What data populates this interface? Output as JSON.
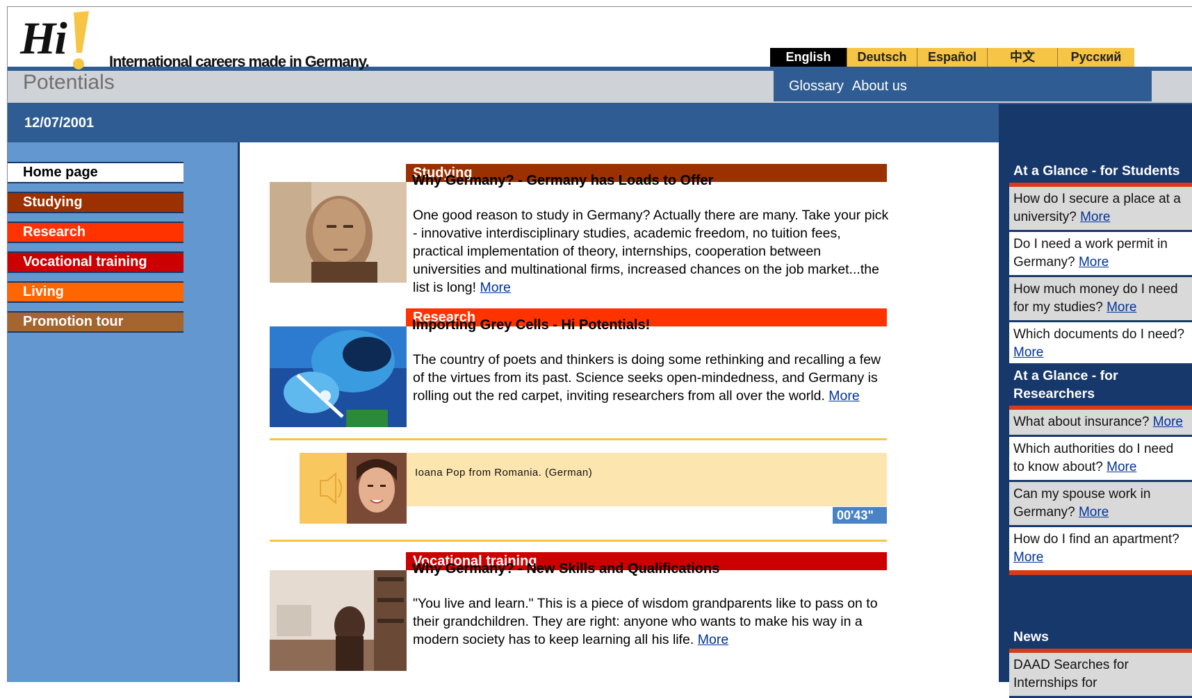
{
  "header": {
    "logo_hi": "Hi",
    "logo_potentials": "Potentials",
    "tagline": "International careers made in Germany."
  },
  "languages": [
    {
      "label": "English",
      "active": true
    },
    {
      "label": "Deutsch",
      "active": false
    },
    {
      "label": "Español",
      "active": false
    },
    {
      "label": "中文",
      "active": false
    },
    {
      "label": "Русский",
      "active": false
    }
  ],
  "subnav": {
    "glossary": "Glossary",
    "about": "About us"
  },
  "date": "12/07/2001",
  "nav": {
    "home": "Home page",
    "studying": "Studying",
    "research": "Research",
    "vocational": "Vocational training",
    "living": "Living",
    "promotion": "Promotion tour"
  },
  "colors": {
    "studying": "#9b3000",
    "research": "#ff3300",
    "vocational": "#cc0000",
    "living": "#ff6600",
    "promotion": "#a5652f",
    "dark_blue": "#17386b",
    "mid_blue": "#2f5d93",
    "light_blue": "#6297cf",
    "gold": "#f6c545"
  },
  "stories": {
    "studying": {
      "section": "Studying",
      "title": "Why Germany? - Germany has Loads to Offer",
      "body": "One good reason to study in Germany? Actually there are many. Take your pick - innovative interdisciplinary studies, academic freedom, no tuition fees, practical implementation of theory, internships, cooperation between universities and multinational firms, increased chances on the job market...the list is long!",
      "more": "More"
    },
    "research": {
      "section": "Research",
      "title": "Importing Grey Cells - Hi Potentials!",
      "body": "The country of poets and thinkers is doing some rethinking and recalling a few of the virtues from its past. Science seeks open-mindedness, and Germany is rolling out the red carpet, inviting researchers from all over the world.",
      "more": "More"
    },
    "audio": {
      "caption": "Ioana Pop from Romania. (German)",
      "duration": "00'43\"",
      "play_glyph": "►"
    },
    "vocational": {
      "section": "Vocational training",
      "title": "Why Germany? - New Skills and Qualifications",
      "body": "\"You live and learn.\" This is a piece of wisdom grandparents like to pass on to their grandchildren. They are right: anyone who wants to make his way in a modern society has to keep learning all his life.",
      "more": "More"
    }
  },
  "sidebar": {
    "students": {
      "heading": "At a Glance - for Students",
      "items": [
        {
          "text": "How do I secure a place at a university?",
          "more": "More"
        },
        {
          "text": "Do I need a work permit in Germany?",
          "more": "More"
        },
        {
          "text": "How much money do I need for my studies?",
          "more": "More"
        },
        {
          "text": "Which documents do I need?",
          "more": "More"
        }
      ]
    },
    "researchers": {
      "heading": "At a Glance - for Researchers",
      "items": [
        {
          "text": "What about insurance?",
          "more": "More"
        },
        {
          "text": "Which authorities do I need to know about?",
          "more": "More"
        },
        {
          "text": "Can my spouse work in Germany?",
          "more": "More"
        },
        {
          "text": "How do I find an apartment?",
          "more": "More"
        }
      ]
    },
    "news": {
      "heading": "News",
      "items": [
        {
          "text": "DAAD Searches for Internships for"
        }
      ]
    }
  }
}
